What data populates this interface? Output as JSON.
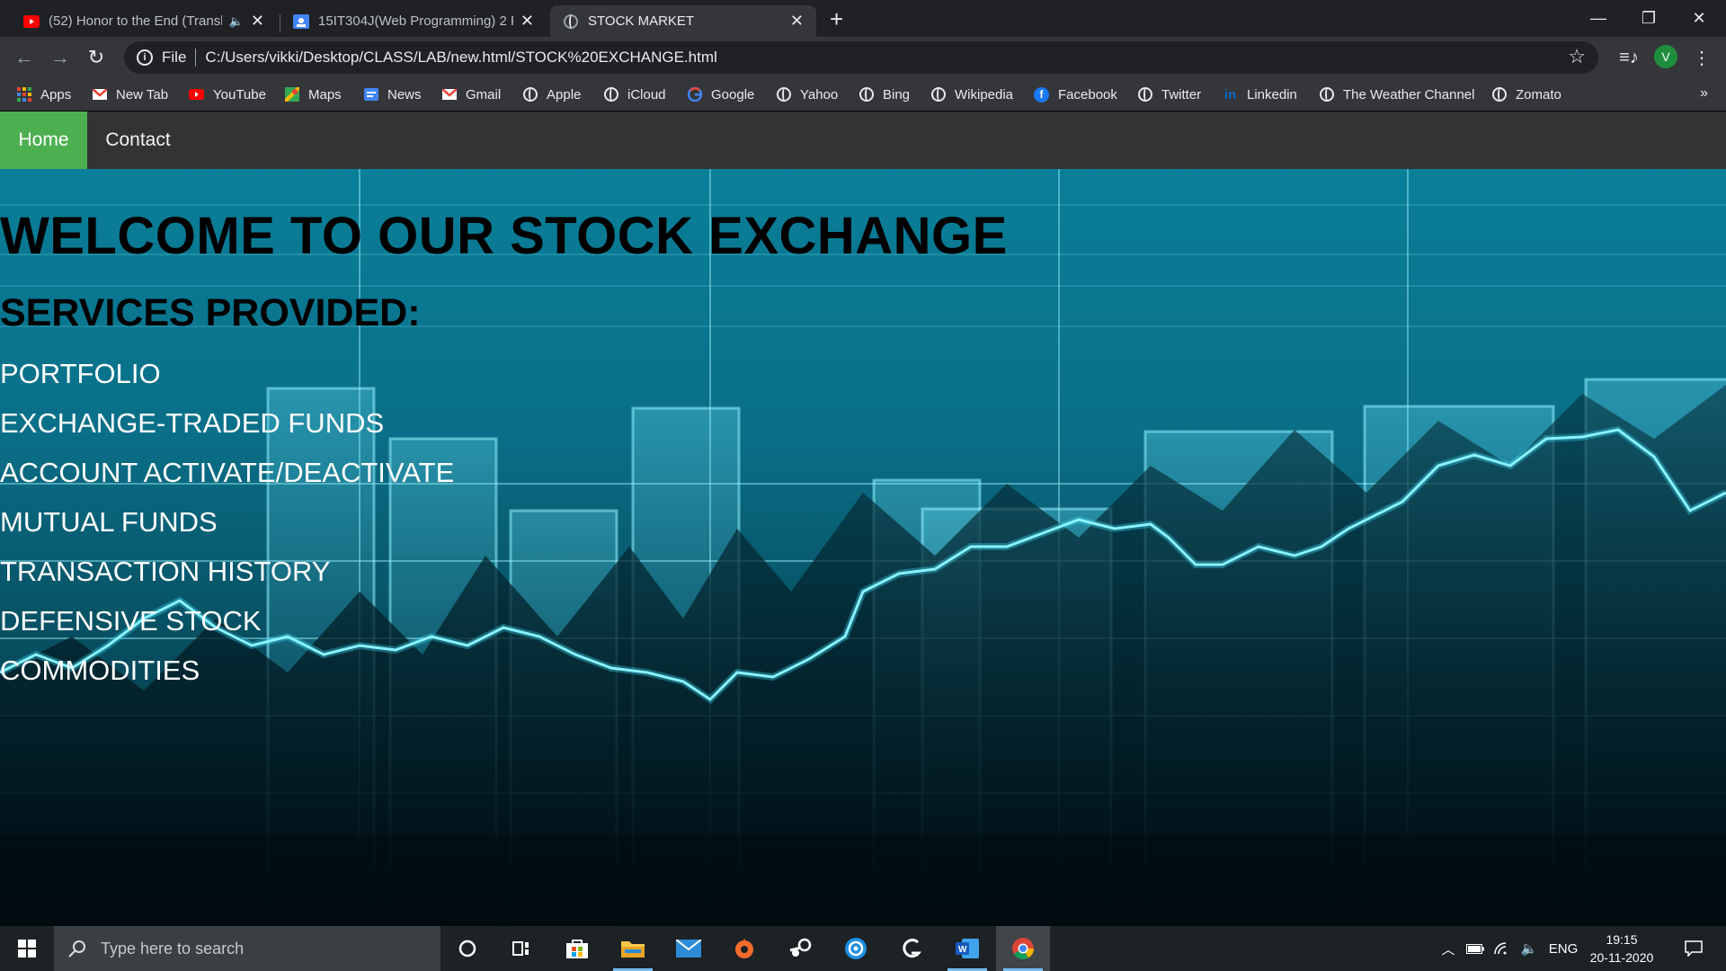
{
  "browser": {
    "tabs": [
      {
        "title": "(52) Honor to the End (Transl",
        "icon": "youtube-icon"
      },
      {
        "title": "15IT304J(Web Programming) 2 P",
        "icon": "classroom-icon"
      },
      {
        "title": "STOCK MARKET",
        "icon": "globe-icon"
      }
    ],
    "address": {
      "scheme_label": "File",
      "url": "C:/Users/vikki/Desktop/CLASS/LAB/new.html/STOCK%20EXCHANGE.html"
    },
    "profile_initial": "V",
    "bookmarks": [
      {
        "label": "Apps",
        "icon": "apps-grid-icon"
      },
      {
        "label": "New Tab",
        "icon": "gmail-icon"
      },
      {
        "label": "YouTube",
        "icon": "youtube-icon"
      },
      {
        "label": "Maps",
        "icon": "maps-icon"
      },
      {
        "label": "News",
        "icon": "news-icon"
      },
      {
        "label": "Gmail",
        "icon": "gmail-icon"
      },
      {
        "label": "Apple",
        "icon": "globe-icon"
      },
      {
        "label": "iCloud",
        "icon": "globe-icon"
      },
      {
        "label": "Google",
        "icon": "google-icon"
      },
      {
        "label": "Yahoo",
        "icon": "globe-icon"
      },
      {
        "label": "Bing",
        "icon": "globe-icon"
      },
      {
        "label": "Wikipedia",
        "icon": "globe-icon"
      },
      {
        "label": "Facebook",
        "icon": "facebook-icon"
      },
      {
        "label": "Twitter",
        "icon": "globe-icon"
      },
      {
        "label": "Linkedin",
        "icon": "linkedin-icon"
      },
      {
        "label": "The Weather Channel",
        "icon": "globe-icon"
      },
      {
        "label": "Zomato",
        "icon": "globe-icon"
      }
    ]
  },
  "page": {
    "nav": [
      {
        "label": "Home",
        "active": true
      },
      {
        "label": "Contact",
        "active": false
      }
    ],
    "heading": "WELCOME TO OUR STOCK EXCHANGE",
    "subheading": "SERVICES PROVIDED:",
    "services": [
      "PORTFOLIO",
      "EXCHANGE-TRADED FUNDS",
      "ACCOUNT ACTIVATE/DEACTIVATE",
      "MUTUAL FUNDS",
      "TRANSACTION HISTORY",
      "DEFENSIVE STOCK",
      "COMMODITIES"
    ],
    "colors": {
      "nav_bg": "#333333",
      "nav_active": "#4caf50",
      "heading": "#000000",
      "service_text": "#ffffff",
      "hero_tint": "#0a7d97"
    }
  },
  "taskbar": {
    "search_placeholder": "Type here to search",
    "apps": [
      "cortana-icon",
      "task-view-icon",
      "store-icon",
      "file-explorer-icon",
      "mail-icon",
      "origin-icon",
      "steam-icon",
      "uplay-icon",
      "logitech-icon",
      "word-icon",
      "chrome-icon"
    ],
    "language": "ENG",
    "time": "19:15",
    "date": "20-11-2020"
  }
}
